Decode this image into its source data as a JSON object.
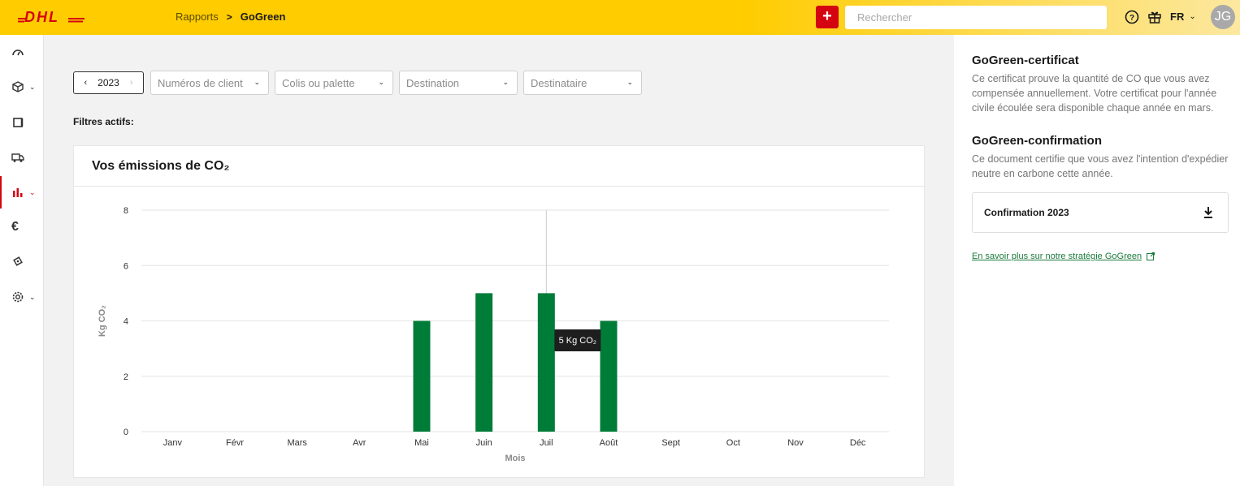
{
  "header": {
    "logo_text": "DHL",
    "breadcrumb": {
      "parent": "Rapports",
      "separator": ">",
      "current": "GoGreen"
    },
    "add_label": "+",
    "search_placeholder": "Rechercher",
    "language": "FR",
    "avatar_initials": "JG"
  },
  "sidebar": {
    "items": [
      {
        "icon": "dashboard-gauge-icon"
      },
      {
        "icon": "package-icon",
        "has_submenu": true
      },
      {
        "icon": "document-icon"
      },
      {
        "icon": "truck-icon"
      },
      {
        "icon": "bar-chart-icon",
        "has_submenu": true,
        "active": true
      },
      {
        "icon": "euro-icon",
        "label": "€"
      },
      {
        "icon": "ticket-icon"
      },
      {
        "icon": "settings-gear-icon",
        "has_submenu": true
      }
    ],
    "active_color": "#d40511"
  },
  "filters": {
    "year": "2023",
    "customer_numbers": "Numéros de client",
    "parcel_or_pallet": "Colis ou palette",
    "destination": "Destination",
    "recipient": "Destinataire",
    "active_label": "Filtres actifs:"
  },
  "chart_card": {
    "title": "Vos émissions de CO₂"
  },
  "chart_data": {
    "type": "bar",
    "categories": [
      "Janv",
      "Févr",
      "Mars",
      "Avr",
      "Mai",
      "Juin",
      "Juil",
      "Août",
      "Sept",
      "Oct",
      "Nov",
      "Déc"
    ],
    "values": [
      0,
      0,
      0,
      0,
      4,
      5,
      5,
      4,
      0,
      0,
      0,
      0
    ],
    "xlabel": "Mois",
    "ylabel": "Kg CO₂",
    "ylim": [
      0,
      8
    ],
    "yticks": [
      0,
      2,
      4,
      6,
      8
    ],
    "grid": true,
    "bar_color": "#007c39",
    "tooltip": {
      "category": "Juil",
      "text": "5 Kg CO₂"
    }
  },
  "right_panel": {
    "certificate_title": "GoGreen-certificat",
    "certificate_text": "Ce certificat prouve la quantité de CO que vous avez compensée annuellement. Votre certificat pour l'année civile écoulée sera disponible chaque année en mars.",
    "confirmation_title": "GoGreen-confirmation",
    "confirmation_text": "Ce document certifie que vous avez l'intention d'expédier neutre en carbone cette année.",
    "confirmation_item": "Confirmation 2023",
    "strategy_link": "En savoir plus sur notre stratégie GoGreen"
  },
  "colors": {
    "brand_yellow": "#ffcc00",
    "brand_red": "#d40511",
    "green": "#007c39"
  }
}
